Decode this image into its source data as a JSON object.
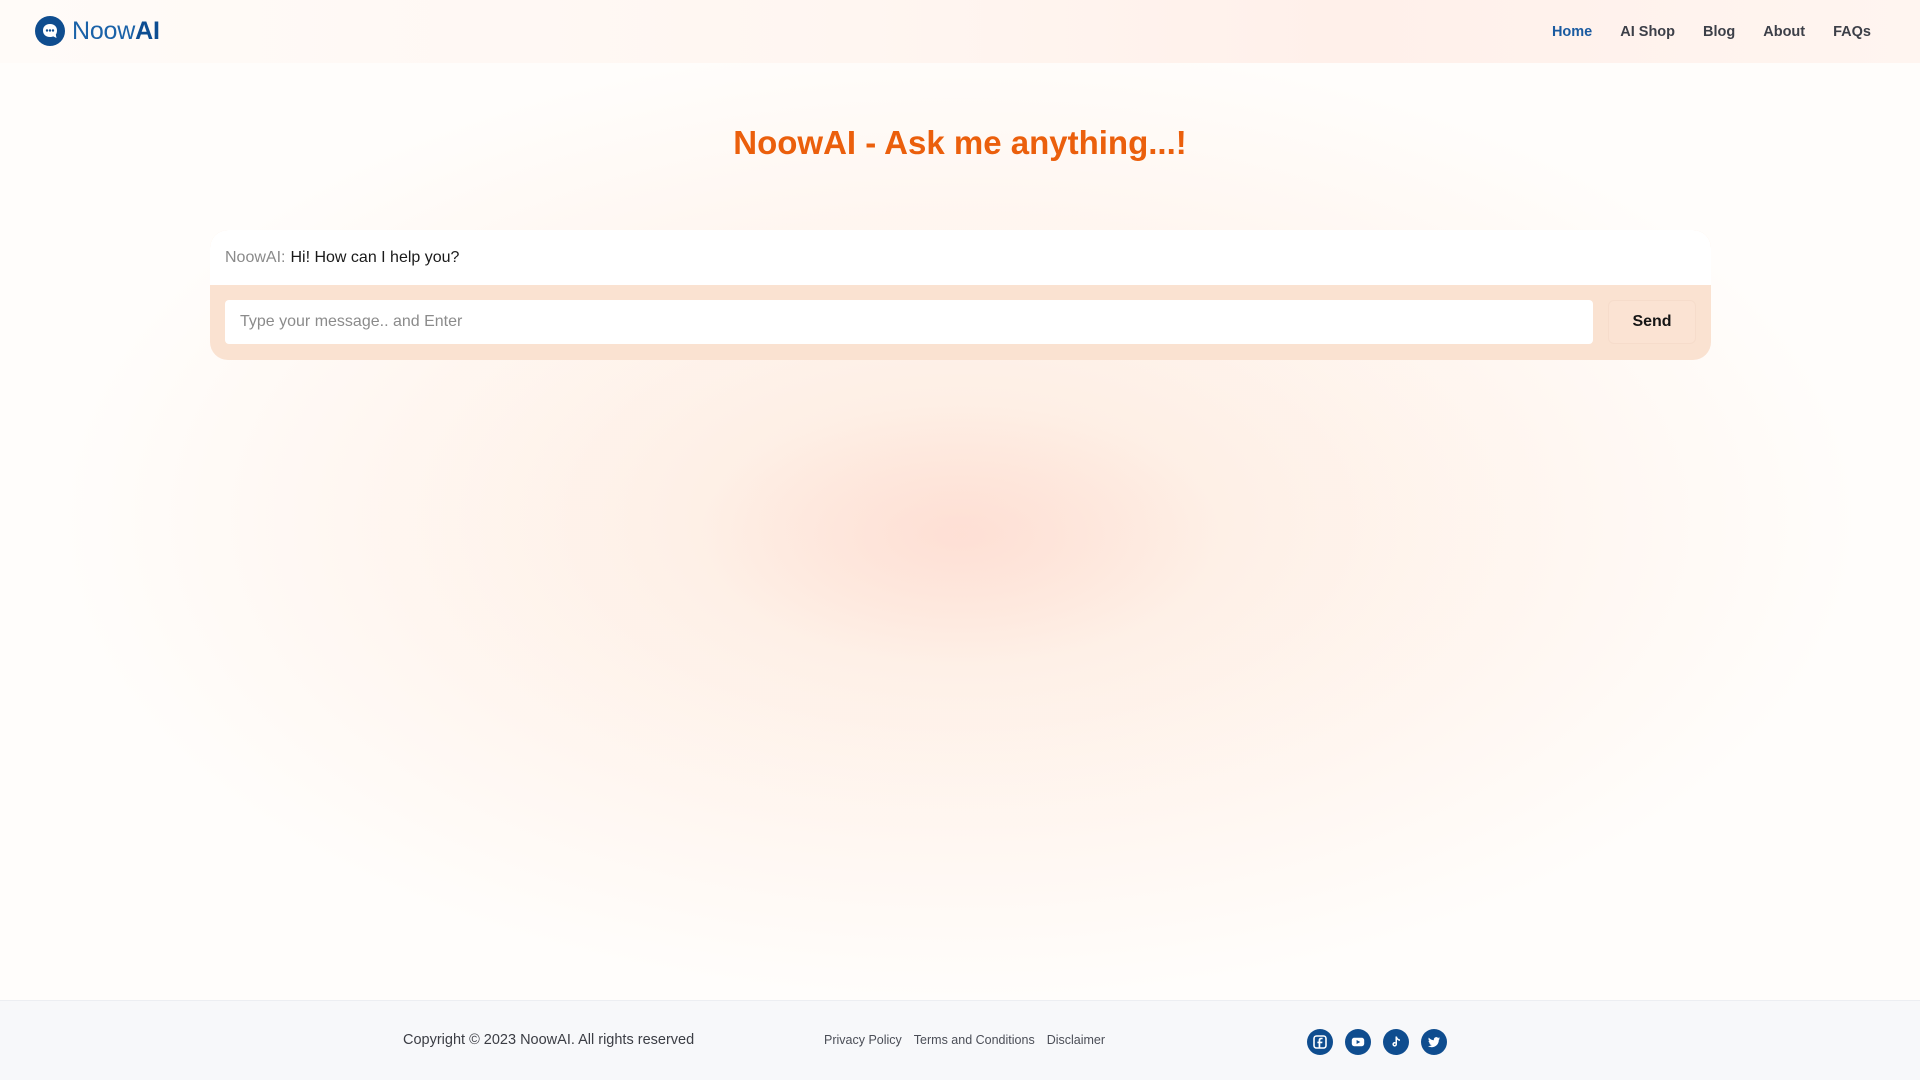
{
  "brand": {
    "name_part1": "Noow",
    "name_part2": "AI",
    "primary_color": "#0f4d8f",
    "accent_color": "#eb5f0c"
  },
  "nav": {
    "items": [
      {
        "label": "Home",
        "active": true
      },
      {
        "label": "AI Shop",
        "active": false
      },
      {
        "label": "Blog",
        "active": false
      },
      {
        "label": "About",
        "active": false
      },
      {
        "label": "FAQs",
        "active": false
      }
    ]
  },
  "main": {
    "title": "NoowAI - Ask me anything...!"
  },
  "chat": {
    "messages": [
      {
        "sender": "NoowAI:",
        "text": "Hi! How can I help you?"
      }
    ],
    "input_placeholder": "Type your message.. and Enter",
    "input_value": "",
    "send_label": "Send"
  },
  "footer": {
    "copyright": "Copyright © 2023 NoowAI. All rights reserved",
    "links": [
      "Privacy Policy",
      "Terms and Conditions",
      "Disclaimer"
    ],
    "socials": [
      "facebook-icon",
      "youtube-icon",
      "tiktok-icon",
      "twitter-icon"
    ]
  }
}
